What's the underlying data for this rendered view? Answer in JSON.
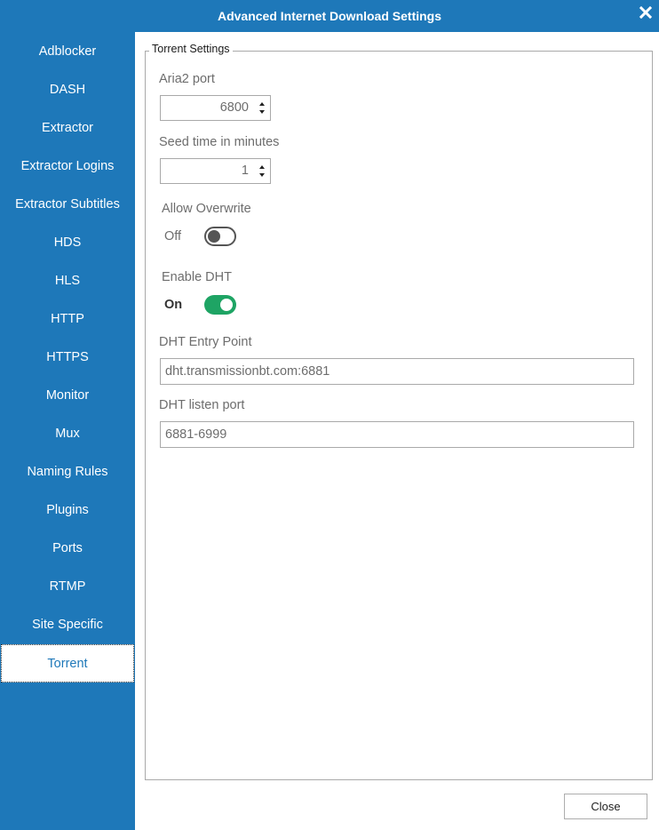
{
  "window": {
    "title": "Advanced Internet Download Settings",
    "close_icon": "close-icon"
  },
  "sidebar": {
    "items": [
      {
        "label": "Adblocker"
      },
      {
        "label": "DASH"
      },
      {
        "label": "Extractor"
      },
      {
        "label": "Extractor Logins"
      },
      {
        "label": "Extractor Subtitles"
      },
      {
        "label": "HDS"
      },
      {
        "label": "HLS"
      },
      {
        "label": "HTTP"
      },
      {
        "label": "HTTPS"
      },
      {
        "label": "Monitor"
      },
      {
        "label": "Mux"
      },
      {
        "label": "Naming Rules"
      },
      {
        "label": "Plugins"
      },
      {
        "label": "Ports"
      },
      {
        "label": "RTMP"
      },
      {
        "label": "Site Specific"
      },
      {
        "label": "Torrent"
      }
    ],
    "selected": "Torrent",
    "color": "#1e78b9"
  },
  "torrent": {
    "group_title": "Torrent Settings",
    "aria2_port": {
      "label": "Aria2 port",
      "value": "6800"
    },
    "seed_time": {
      "label": "Seed time in minutes",
      "value": "1"
    },
    "allow_overwrite": {
      "label": "Allow Overwrite",
      "state_label": "Off",
      "on": false
    },
    "enable_dht": {
      "label": "Enable DHT",
      "state_label": "On",
      "on": true,
      "color": "#1ea464"
    },
    "dht_entry_point": {
      "label": "DHT Entry Point",
      "value": "dht.transmissionbt.com:6881"
    },
    "dht_listen_port": {
      "label": "DHT listen port",
      "value": "6881-6999"
    }
  },
  "footer": {
    "close_label": "Close"
  }
}
